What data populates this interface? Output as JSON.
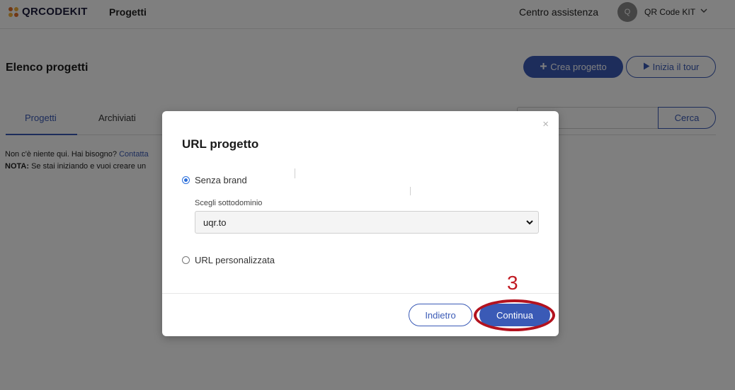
{
  "header": {
    "logo_text": "QRCODEKIT",
    "nav_projects": "Progetti",
    "help_link": "Centro assistenza",
    "avatar_initial": "Q",
    "account_name": "QR Code KIT"
  },
  "page": {
    "title": "Elenco progetti",
    "create_button": "Crea progetto",
    "tour_button": "Inizia il tour",
    "tabs": [
      {
        "label": "Progetti",
        "active": true
      },
      {
        "label": "Archiviati",
        "active": false
      }
    ],
    "search_button": "Cerca",
    "empty_text": "Non c'è niente qui. Hai bisogno? ",
    "empty_link": "Contatta",
    "note_label": "NOTA:",
    "note_text": " Se stai iniziando e vuoi creare un"
  },
  "modal": {
    "title": "URL progetto",
    "close_glyph": "×",
    "options": [
      {
        "label": "Senza brand",
        "checked": true
      },
      {
        "label": "URL personalizzata",
        "checked": false
      }
    ],
    "subdomain_label": "Scegli sottodominio",
    "subdomain_value": "uqr.to",
    "back_button": "Indietro",
    "continue_button": "Continua"
  },
  "annotation": {
    "step_number": "3",
    "color": "#c11b23"
  },
  "colors": {
    "accent": "#3a5ab6",
    "overlay": "rgba(0,0,0,0.5)"
  }
}
